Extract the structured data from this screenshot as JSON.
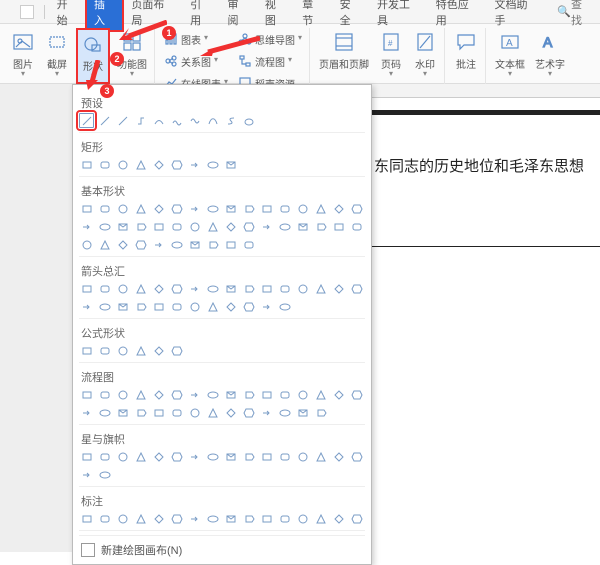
{
  "menu": {
    "tabs": [
      "开始",
      "插入",
      "页面布局",
      "引用",
      "审阅",
      "视图",
      "章节",
      "安全",
      "开发工具",
      "特色应用",
      "文档助手"
    ],
    "active_index": 1,
    "search_label": "查找"
  },
  "ribbon": {
    "picture": "图片",
    "screenshot": "截屏",
    "shapes": "形状",
    "icon_lib": "功能图",
    "chart": "图表",
    "relation": "关系图",
    "online_chart": "在线图表",
    "smartart": "思维导图",
    "flowchart": "流程图",
    "more_resource": "稻壳资源",
    "header_footer": "页眉和页脚",
    "page_number": "页码",
    "watermark": "水印",
    "comment": "批注",
    "textbox": "文本框",
    "wordart": "艺术字"
  },
  "annotations": {
    "b1": "1",
    "b2": "2",
    "b3": "3"
  },
  "shapes_panel": {
    "presets": "预设",
    "rectangles": "矩形",
    "basic": "基本形状",
    "arrows": "箭头总汇",
    "equation": "公式形状",
    "flowchart": "流程图",
    "stars": "星与旗帜",
    "callouts": "标注",
    "new_canvas": "新建绘图画布(N)"
  },
  "document": {
    "text_line": "东同志的历史地位和毛泽东思想"
  }
}
